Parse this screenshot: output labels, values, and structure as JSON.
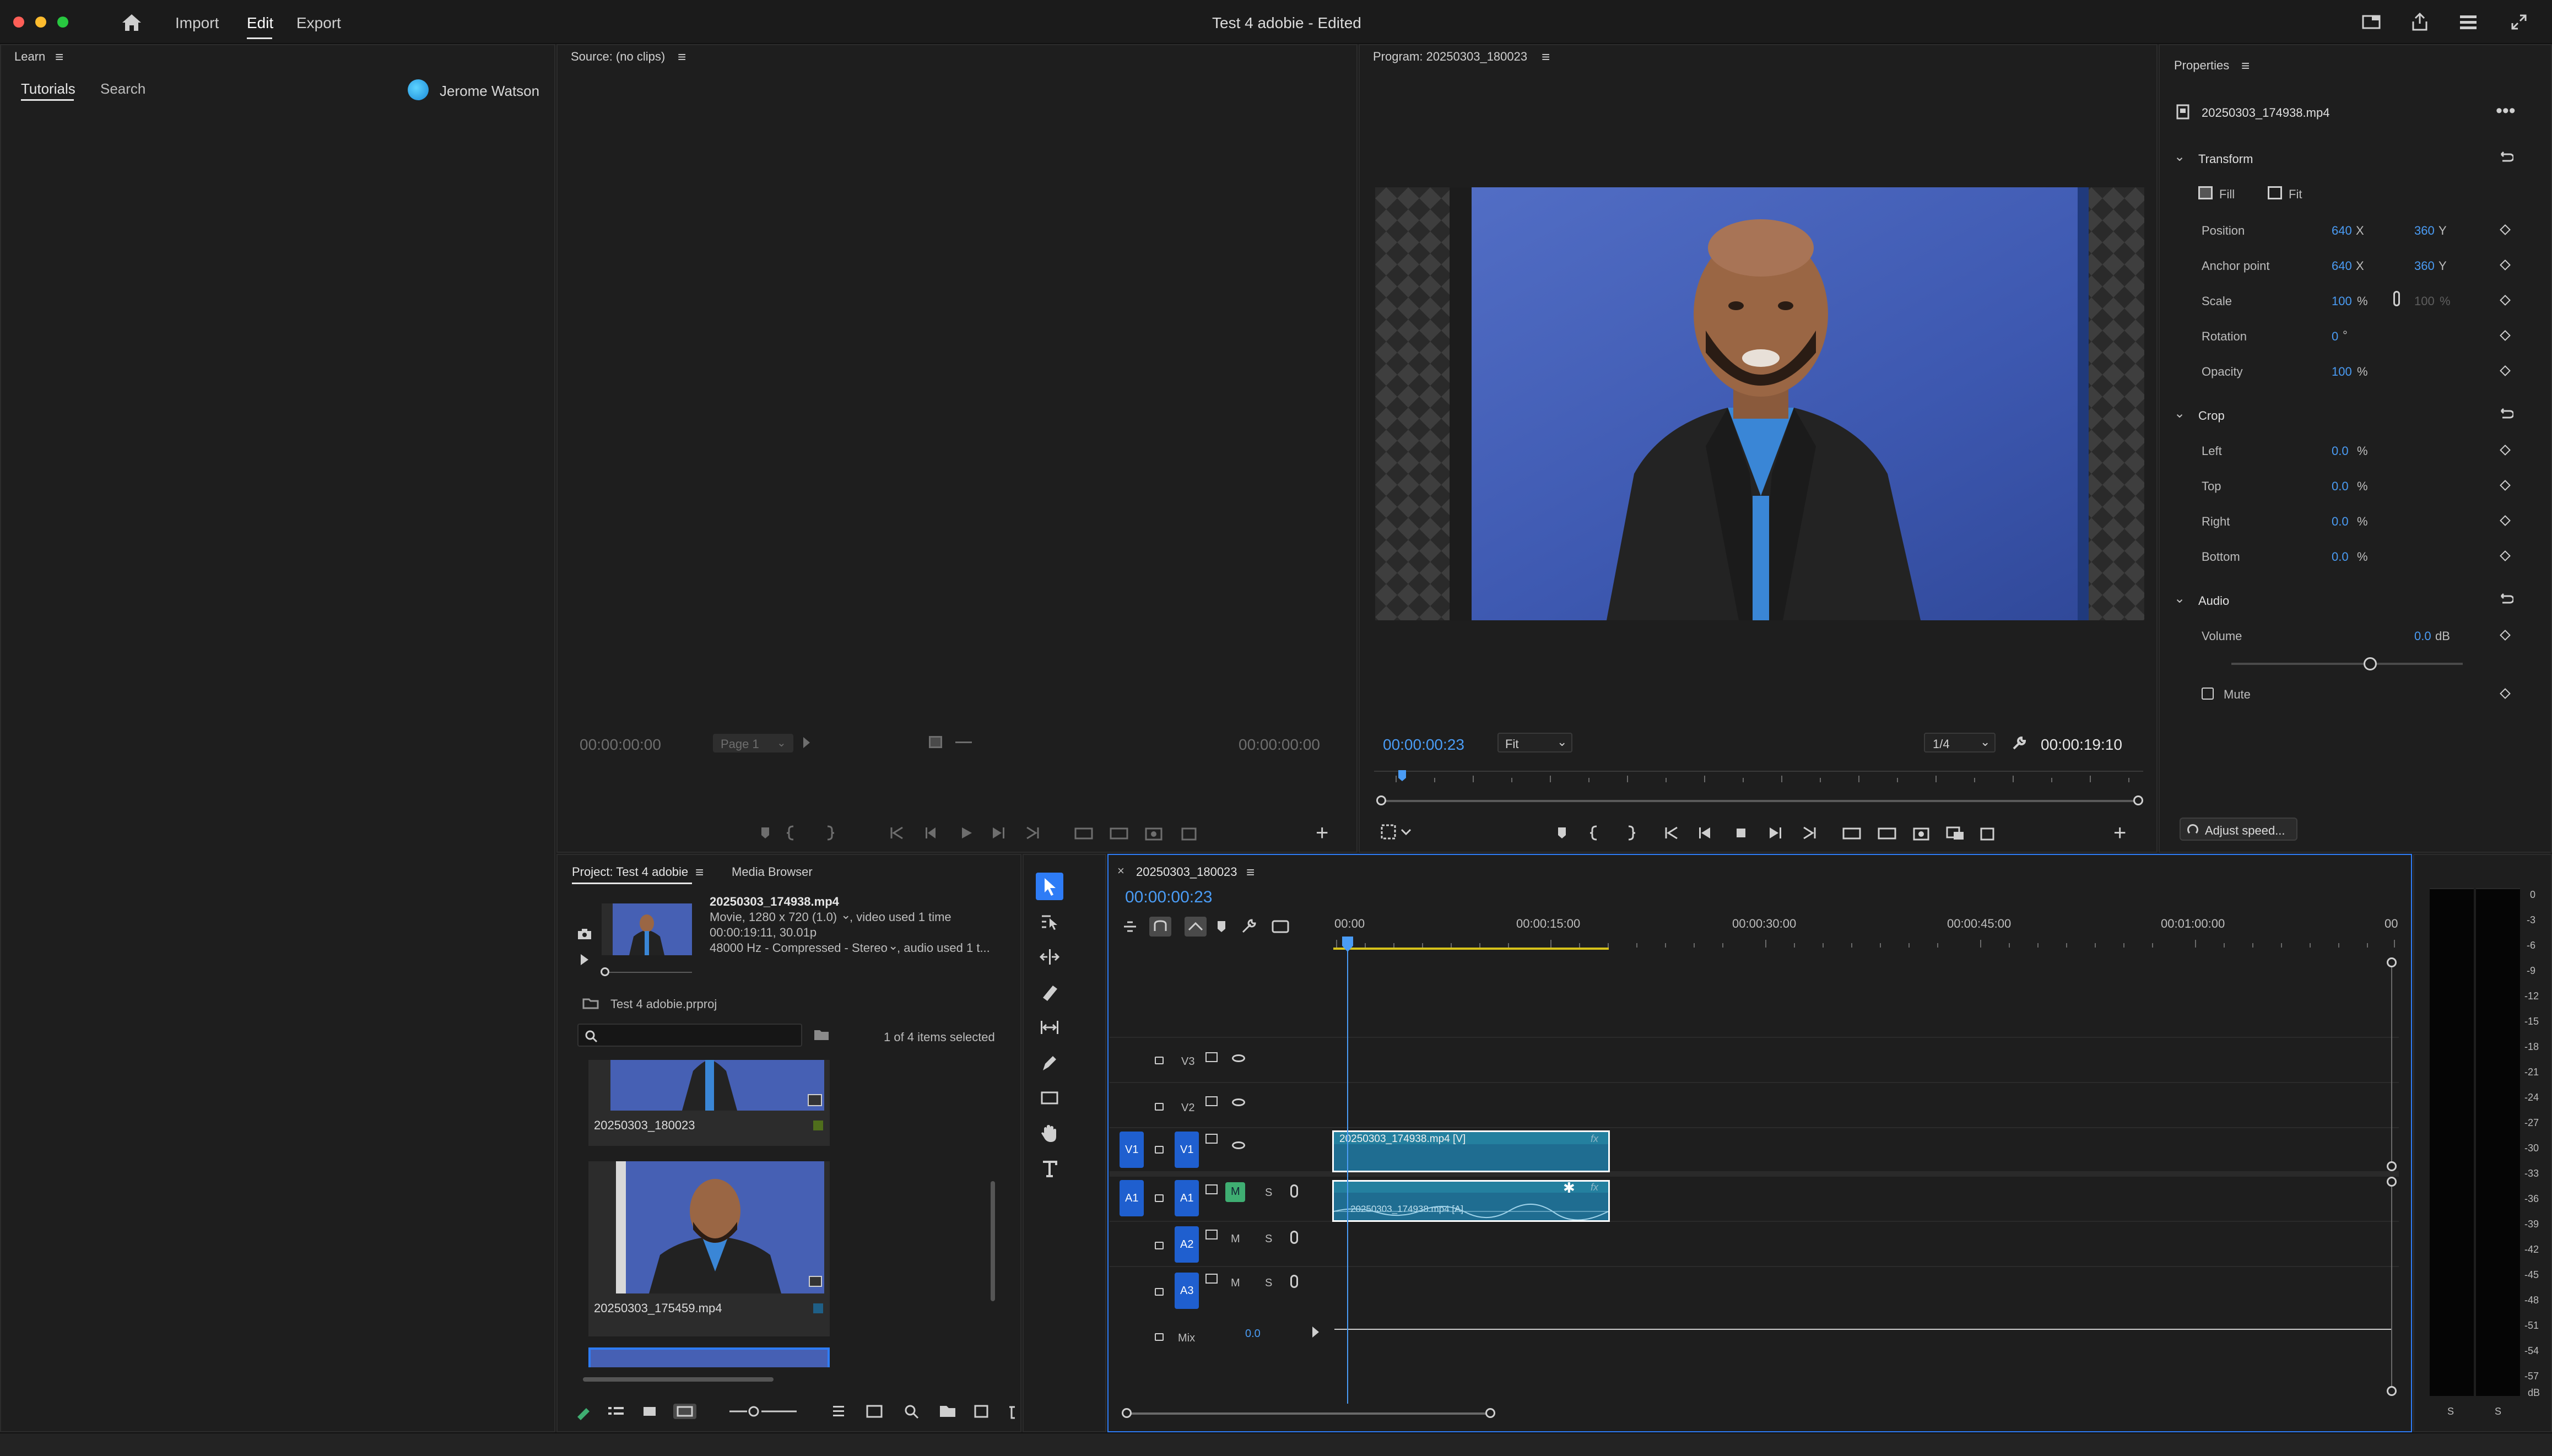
{
  "titlebar": {
    "menu": [
      "Import",
      "Edit",
      "Export"
    ],
    "active_menu": "Edit",
    "title": "Test 4 adobie - Edited"
  },
  "learn": {
    "title": "Learn",
    "tabs": [
      "Tutorials",
      "Search"
    ],
    "user": "Jerome Watson"
  },
  "source": {
    "title": "Source: (no clips)",
    "tc_left": "00:00:00:00",
    "page_select": "Page 1",
    "tc_right": "00:00:00:00"
  },
  "program": {
    "title": "Program: 20250303_180023",
    "tc_current": "00:00:00:23",
    "fit": "Fit",
    "resolution": "1/4",
    "tc_duration": "00:00:19:10"
  },
  "properties": {
    "title": "Properties",
    "clip_name": "20250303_174938.mp4",
    "transform_label": "Transform",
    "fill_label": "Fill",
    "fit_label": "Fit",
    "position_label": "Position",
    "position_x": "640",
    "position_y": "360",
    "x_label": "X",
    "y_label": "Y",
    "anchor_label": "Anchor point",
    "anchor_x": "640",
    "anchor_y": "360",
    "scale_label": "Scale",
    "scale_value": "100",
    "scale_value_2": "100",
    "percent": "%",
    "rotation_label": "Rotation",
    "rotation_value": "0",
    "degree": "°",
    "opacity_label": "Opacity",
    "opacity_value": "100",
    "crop_label": "Crop",
    "left_label": "Left",
    "left_value": "0.0",
    "top_label": "Top",
    "top_value": "0.0",
    "right_label": "Right",
    "right_value": "0.0",
    "bottom_label": "Bottom",
    "bottom_value": "0.0",
    "audio_label": "Audio",
    "volume_label": "Volume",
    "volume_value": "0.0",
    "db_unit": "dB",
    "volume_level": 0.6,
    "mute_label": "Mute",
    "adjust_speed": "Adjust speed..."
  },
  "project": {
    "tab_project": "Project: Test 4 adobie",
    "tab_media": "Media Browser",
    "clip_name": "20250303_174938.mp4",
    "clip_line1": "Movie, 1280 x 720 (1.0)",
    "clip_line1b": ", video used 1 time",
    "clip_line2": "00:00:19:11, 30.01p",
    "clip_line3": "48000 Hz - Compressed - Stereo",
    "clip_line3b": ", audio used 1 t...",
    "project_file": "Test 4 adobie.prproj",
    "search_placeholder": "",
    "selection_count": "1 of 4 items selected",
    "items": [
      {
        "name": "20250303_180023",
        "badge_color": "#4f6e1c"
      },
      {
        "name": "20250303_175459.mp4",
        "badge_color": "#1f5f86"
      }
    ]
  },
  "timeline": {
    "sequence": "20250303_180023",
    "timecode": "00:00:00:23",
    "ruler": [
      "00:00",
      "00:00:15:00",
      "00:00:30:00",
      "00:00:45:00",
      "00:01:00:00",
      "00"
    ],
    "tracks_video": [
      {
        "name": "V3",
        "src": "",
        "toggle": ""
      },
      {
        "name": "V2",
        "src": "",
        "toggle": ""
      },
      {
        "name": "V1",
        "src": "V1",
        "toggle": "V1"
      }
    ],
    "tracks_audio": [
      {
        "name": "A1",
        "src": "A1",
        "toggle": "A1",
        "m": "M",
        "s": "S"
      },
      {
        "name": "A2",
        "src": "",
        "toggle": "A2",
        "m": "M",
        "s": "S"
      },
      {
        "name": "A3",
        "src": "",
        "toggle": "A3",
        "m": "M",
        "s": "S"
      }
    ],
    "mix_label": "Mix",
    "mix_value": "0.0",
    "video_clip": "20250303_174938.mp4 [V]",
    "audio_clip": "20250303_174938.mp4 [A]",
    "fx": "fx"
  },
  "meter": {
    "scale": [
      "0",
      "-3",
      "-6",
      "-9",
      "-12",
      "-15",
      "-18",
      "-21",
      "-24",
      "-27",
      "-30",
      "-33",
      "-36",
      "-39",
      "-42",
      "-45",
      "-48",
      "-51",
      "-54",
      "-57",
      "dB"
    ],
    "solo": [
      "S",
      "S"
    ]
  },
  "colors": {
    "accent": "#2e7cf6",
    "timecode": "#4a9cf5",
    "clip": "#1f6d91",
    "track_blue": "#1f5fcf",
    "mute_green": "#3fae72",
    "playhead": "#4a9cf5"
  }
}
